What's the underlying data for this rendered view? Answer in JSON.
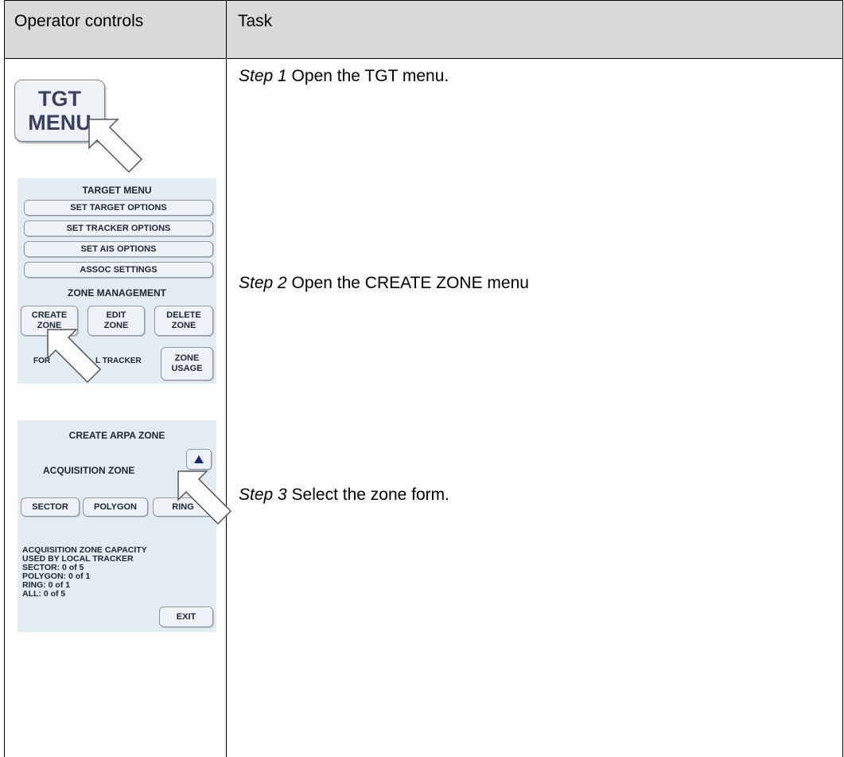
{
  "table": {
    "header": {
      "col1": "Operator controls",
      "col2": "Task"
    },
    "steps": [
      {
        "label": "Step 1",
        "text": " Open the TGT menu."
      },
      {
        "label": "Step 2",
        "text": " Open the CREATE ZONE menu"
      },
      {
        "label": "Step 3",
        "text": " Select the zone form."
      }
    ]
  },
  "tgt_button": {
    "line1": "TGT",
    "line2": "MENU"
  },
  "target_menu": {
    "title": "TARGET MENU",
    "set_target_options": "SET TARGET OPTIONS",
    "set_tracker_options": "SET TRACKER OPTIONS",
    "set_ais_options": "SET AIS OPTIONS",
    "assoc_settings": "ASSOC SETTINGS",
    "zone_management": "ZONE MANAGEMENT",
    "create_zone": {
      "line1": "CREATE",
      "line2": "ZONE"
    },
    "edit_zone": {
      "line1": "EDIT",
      "line2": "ZONE"
    },
    "delete_zone": {
      "line1": "DELETE",
      "line2": "ZONE"
    },
    "tracker_left": "FOR",
    "tracker_right": "L TRACKER",
    "zone_usage": {
      "line1": "ZONE",
      "line2": "USAGE"
    }
  },
  "create_zone_menu": {
    "title": "CREATE ARPA ZONE",
    "zone_type": "ACQUISITION ZONE",
    "sector": "SECTOR",
    "polygon": "POLYGON",
    "ring": "RING",
    "capacity_lines": [
      "ACQUISITION ZONE CAPACITY",
      "USED BY LOCAL TRACKER",
      "SECTOR: 0 of 5",
      "POLYGON: 0 of 1",
      "RING: 0 of 1",
      "ALL: 0 of 5"
    ],
    "exit": "EXIT"
  },
  "icons": {
    "cursor": "pointer-arrow-icon",
    "up": "triangle-up-icon"
  }
}
